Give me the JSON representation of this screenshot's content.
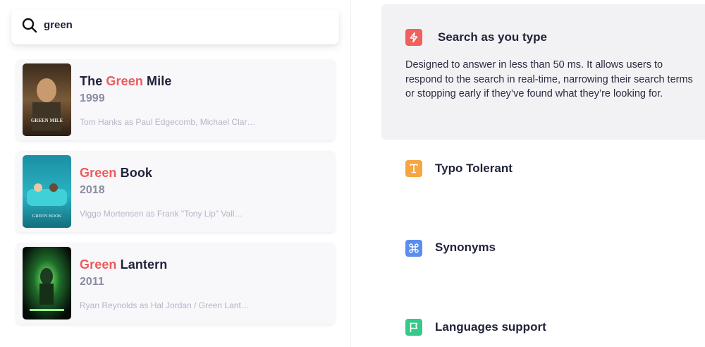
{
  "search": {
    "value": "green",
    "placeholder": "Search"
  },
  "results": [
    {
      "title_pre": "The ",
      "title_hl": "Green",
      "title_post": " Mile",
      "year": "1999",
      "cast": "Tom Hanks as Paul Edgecomb, Michael Clar…",
      "poster_text": "GREEN MILE"
    },
    {
      "title_pre": "",
      "title_hl": "Green",
      "title_post": " Book",
      "year": "2018",
      "cast": "Viggo Mortensen as Frank \"Tony Lip\" Vall…",
      "poster_text": "GREEN BOOK"
    },
    {
      "title_pre": "",
      "title_hl": "Green",
      "title_post": " Lantern",
      "year": "2011",
      "cast": "Ryan Reynolds as Hal Jordan / Green Lant…",
      "poster_text": ""
    }
  ],
  "features": [
    {
      "title": "Search as you type",
      "icon": "lightning-icon",
      "color": "#f0605d",
      "description": "Designed to answer in less than 50 ms. It allows users to respond to the search in real-time, narrowing their search terms or stopping early if they’ve found what they’re looking for."
    },
    {
      "title": "Typo Tolerant",
      "icon": "text-t-icon",
      "color": "#f7a540"
    },
    {
      "title": "Synonyms",
      "icon": "command-icon",
      "color": "#5b8def"
    },
    {
      "title": "Languages support",
      "icon": "flag-icon",
      "color": "#35c98a"
    }
  ],
  "colors": {
    "highlight": "#ef5a5a",
    "text": "#21233a",
    "year": "#8a8ca3",
    "cast": "#b4b6c7"
  }
}
